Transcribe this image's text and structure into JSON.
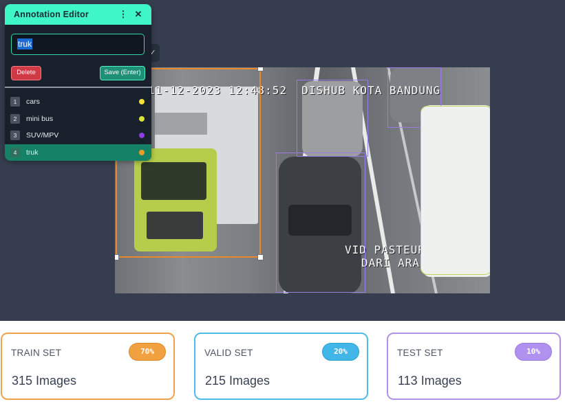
{
  "editor": {
    "title": "Annotation Editor",
    "menu_icon": "⋮",
    "close_icon": "✕",
    "input_value": "truk",
    "delete_label": "Delete",
    "save_label": "Save (Enter)",
    "classes": [
      {
        "num": "1",
        "name": "cars",
        "color": "#f2e33a"
      },
      {
        "num": "2",
        "name": "mini bus",
        "color": "#d9e33a"
      },
      {
        "num": "3",
        "name": "SUV/MPV",
        "color": "#8b3fe0"
      },
      {
        "num": "4",
        "name": "truk",
        "color": "#f09a25",
        "active": true
      }
    ]
  },
  "toolbar": {
    "check_icon": "✓"
  },
  "image": {
    "timestamp": "11-12-2023 12:48:52  DISHUB KOTA BANDUNG",
    "location_line1": "VID PASTEUR BARAT",
    "location_line2": "DARI ARAH TOL"
  },
  "splits": {
    "train": {
      "title": "TRAIN SET",
      "percent": "70%",
      "count": "315 Images"
    },
    "val": {
      "title": "VALID SET",
      "percent": "20%",
      "count": "215 Images"
    },
    "test": {
      "title": "TEST SET",
      "percent": "10%",
      "count": "113 Images"
    }
  }
}
